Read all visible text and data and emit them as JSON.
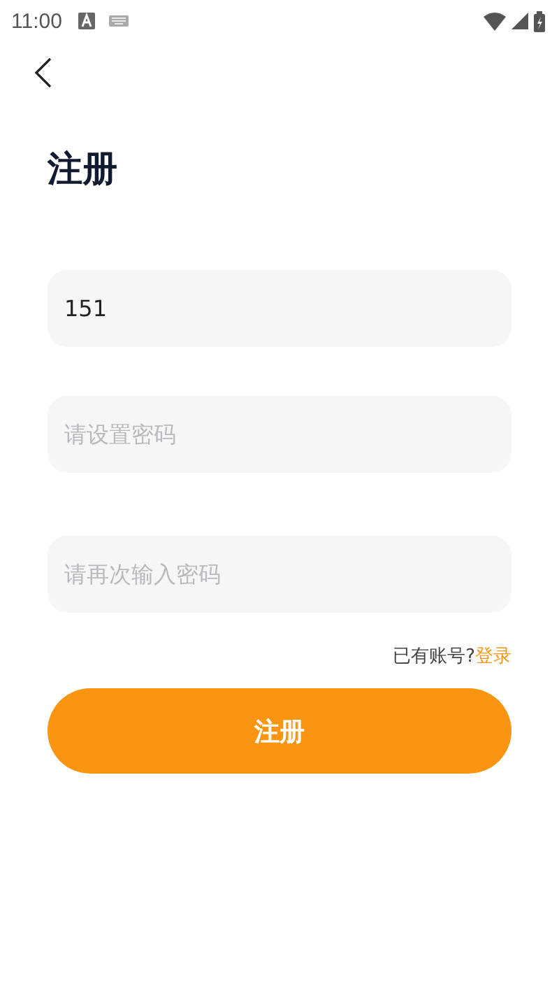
{
  "status_bar": {
    "time": "11:00"
  },
  "title": "注册",
  "fields": [
    {
      "kind": "text",
      "value": "151"
    },
    {
      "kind": "password",
      "placeholder": "请设置密码"
    },
    {
      "kind": "password",
      "placeholder": "请再次输入密码"
    }
  ],
  "login_prompt": {
    "text": "已有账号?",
    "link": "登录"
  },
  "submit_button": "注册"
}
